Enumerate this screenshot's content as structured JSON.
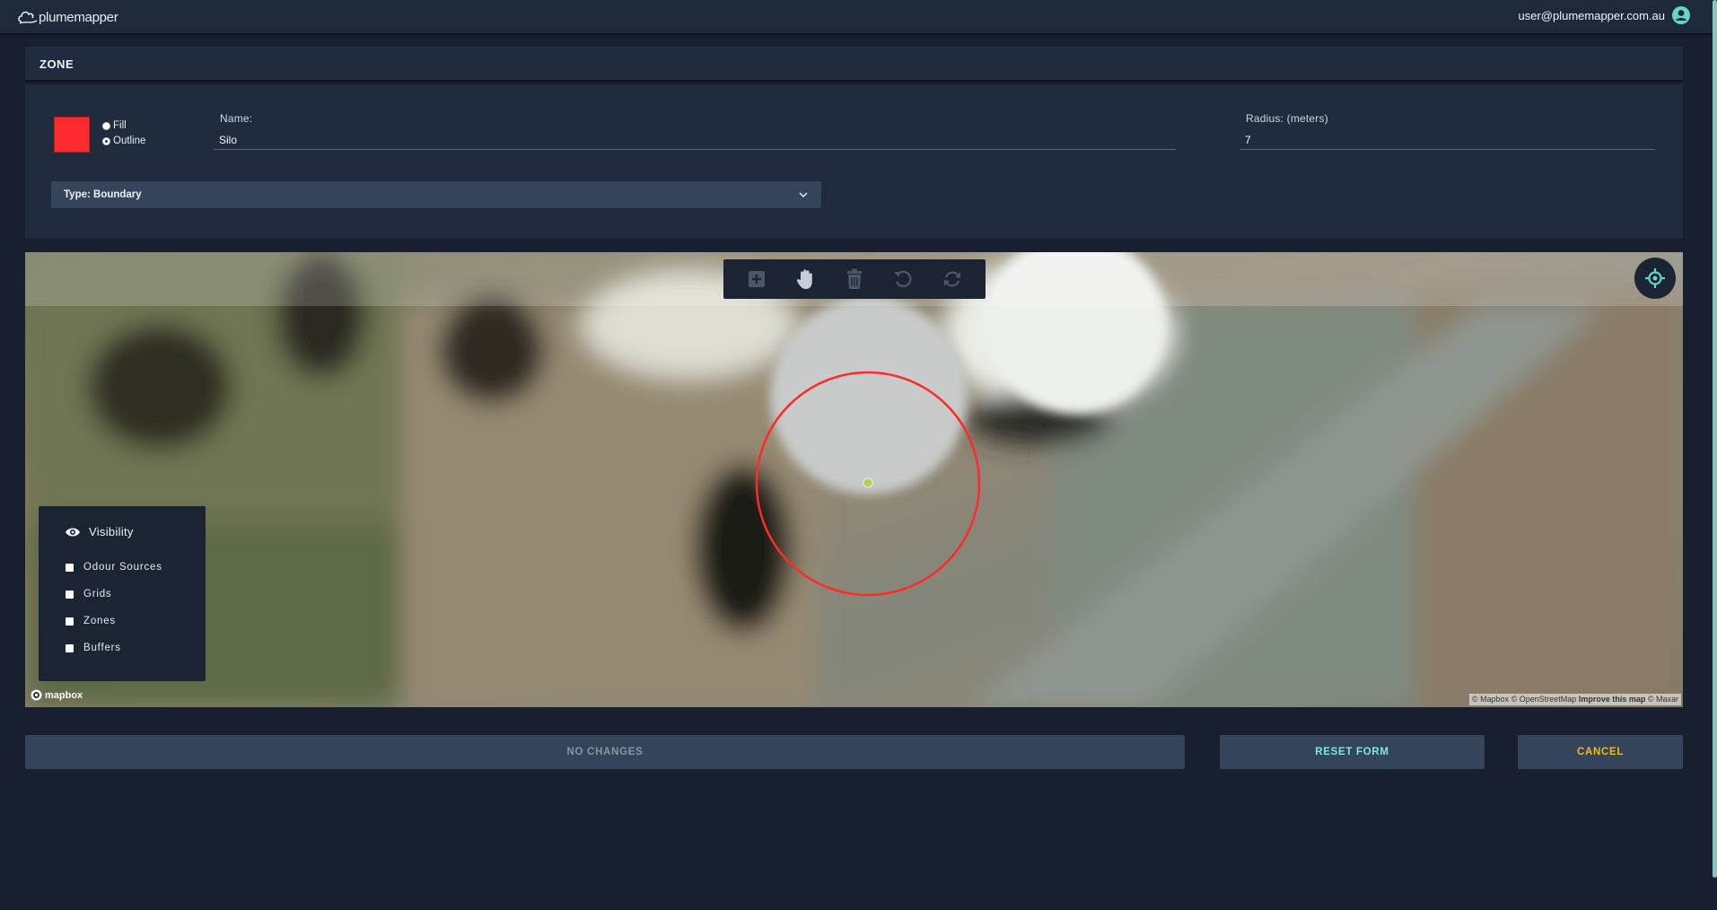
{
  "app": {
    "logo_text": "plumemapper",
    "user_email": "user@plumemapper.com.au"
  },
  "zone": {
    "section_title": "ZONE",
    "color": "#fb2a2e",
    "style_options": [
      {
        "label": "Fill",
        "checked": false
      },
      {
        "label": "Outline",
        "checked": true
      }
    ],
    "name_label": "Name:",
    "name_value": "Silo",
    "radius_label": "Radius: (meters)",
    "radius_value": "7",
    "type_label": "Type: Boundary"
  },
  "map": {
    "toolbar": [
      {
        "name": "add-point-icon"
      },
      {
        "name": "pan-hand-icon"
      },
      {
        "name": "trash-icon"
      },
      {
        "name": "undo-icon"
      },
      {
        "name": "redo-icon"
      }
    ],
    "visibility": {
      "title": "Visibility",
      "items": [
        "Odour Sources",
        "Grids",
        "Zones",
        "Buffers"
      ]
    },
    "mapbox_label": "mapbox",
    "attribution": {
      "mapbox": "© Mapbox",
      "osm": "© OpenStreetMap",
      "improve": "Improve this map",
      "maxar": "© Maxar"
    },
    "zone_circle_color": "#ff2a2a",
    "center_dot_color": "#a8d35a"
  },
  "footer": {
    "no_changes_label": "NO CHANGES",
    "reset_label": "RESET FORM",
    "cancel_label": "CANCEL"
  }
}
